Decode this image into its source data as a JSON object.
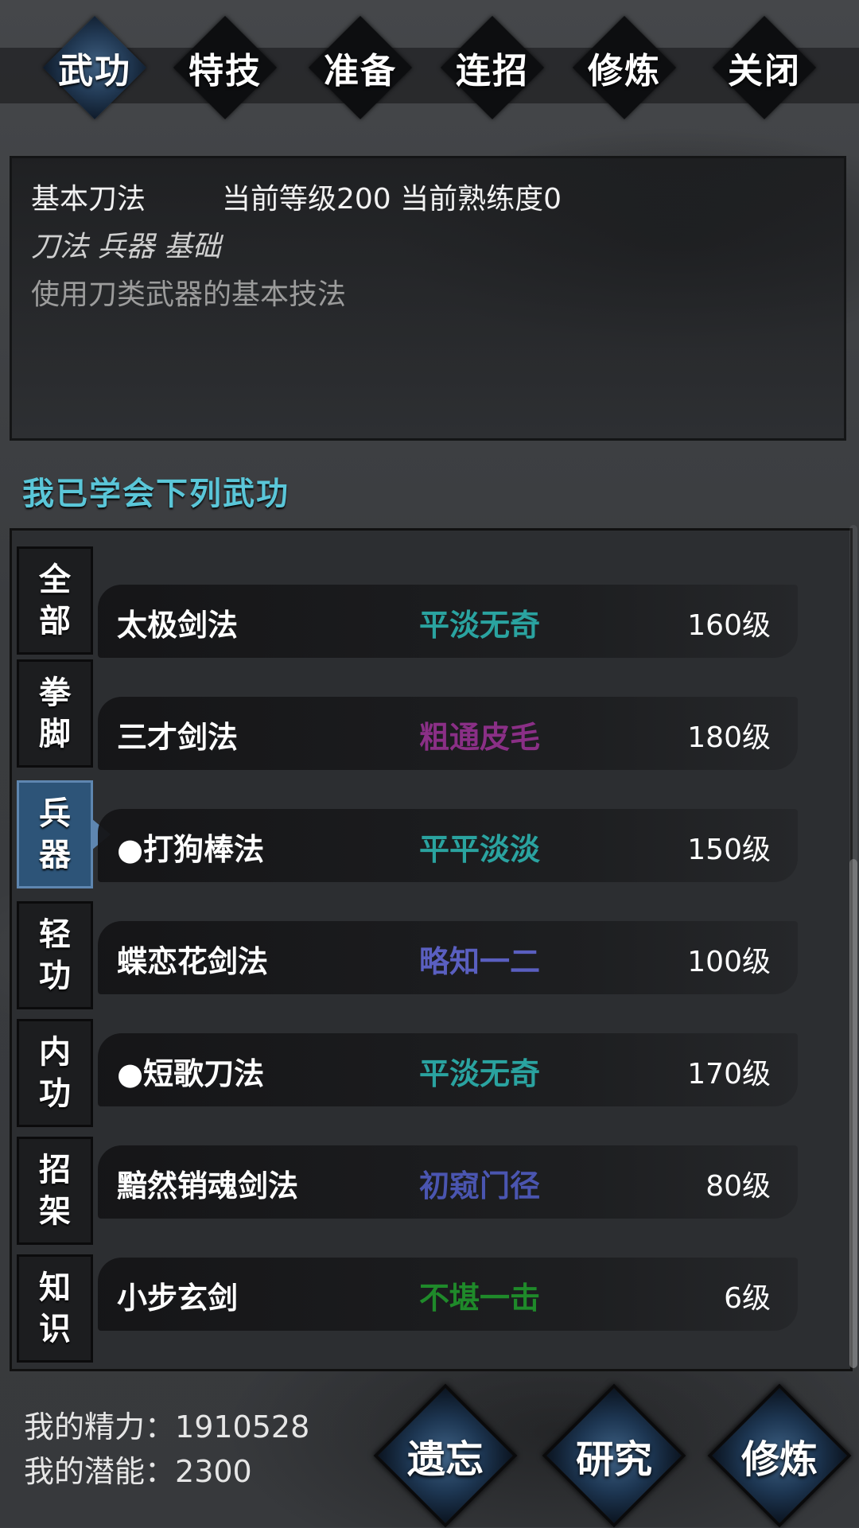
{
  "top_tabs": [
    {
      "label": "武功",
      "active": true
    },
    {
      "label": "特技",
      "active": false
    },
    {
      "label": "准备",
      "active": false
    },
    {
      "label": "连招",
      "active": false
    },
    {
      "label": "修炼",
      "active": false
    },
    {
      "label": "关闭",
      "active": false
    }
  ],
  "info": {
    "skill_name": "基本刀法",
    "level_text": "当前等级200  当前熟练度0",
    "tags": "刀法 兵器 基础",
    "description": "使用刀类武器的基本技法"
  },
  "section_title": "我已学会下列武功",
  "side_tabs": [
    {
      "chars": [
        "全",
        "部"
      ],
      "active": false
    },
    {
      "chars": [
        "拳",
        "脚"
      ],
      "active": false
    },
    {
      "chars": [
        "兵",
        "器"
      ],
      "active": true
    },
    {
      "chars": [
        "轻",
        "功"
      ],
      "active": false
    },
    {
      "chars": [
        "内",
        "功"
      ],
      "active": false
    },
    {
      "chars": [
        "招",
        "架"
      ],
      "active": false
    },
    {
      "chars": [
        "知",
        "识"
      ],
      "active": false
    }
  ],
  "skills": [
    {
      "name": "太极剑法",
      "rank": "平淡无奇",
      "rank_color": "#2aa3a0",
      "level": "160级"
    },
    {
      "name": "三才剑法",
      "rank": "粗通皮毛",
      "rank_color": "#8a2f86",
      "level": "180级"
    },
    {
      "name": "●打狗棒法",
      "rank": "平平淡淡",
      "rank_color": "#2aa3a0",
      "level": "150级"
    },
    {
      "name": "蝶恋花剑法",
      "rank": "略知一二",
      "rank_color": "#5a5fc0",
      "level": "100级"
    },
    {
      "name": "●短歌刀法",
      "rank": "平淡无奇",
      "rank_color": "#2aa3a0",
      "level": "170级"
    },
    {
      "name": "黯然销魂剑法",
      "rank": "初窥门径",
      "rank_color": "#4a55b0",
      "level": "80级"
    },
    {
      "name": "小步玄剑",
      "rank": "不堪一击",
      "rank_color": "#1f8a2a",
      "level": "6级"
    }
  ],
  "stats": {
    "energy_label": "我的精力：",
    "energy_value": "1910528",
    "potential_label": "我的潜能：",
    "potential_value": "2300"
  },
  "actions": [
    {
      "label": "遗忘"
    },
    {
      "label": "研究"
    },
    {
      "label": "修炼"
    }
  ]
}
